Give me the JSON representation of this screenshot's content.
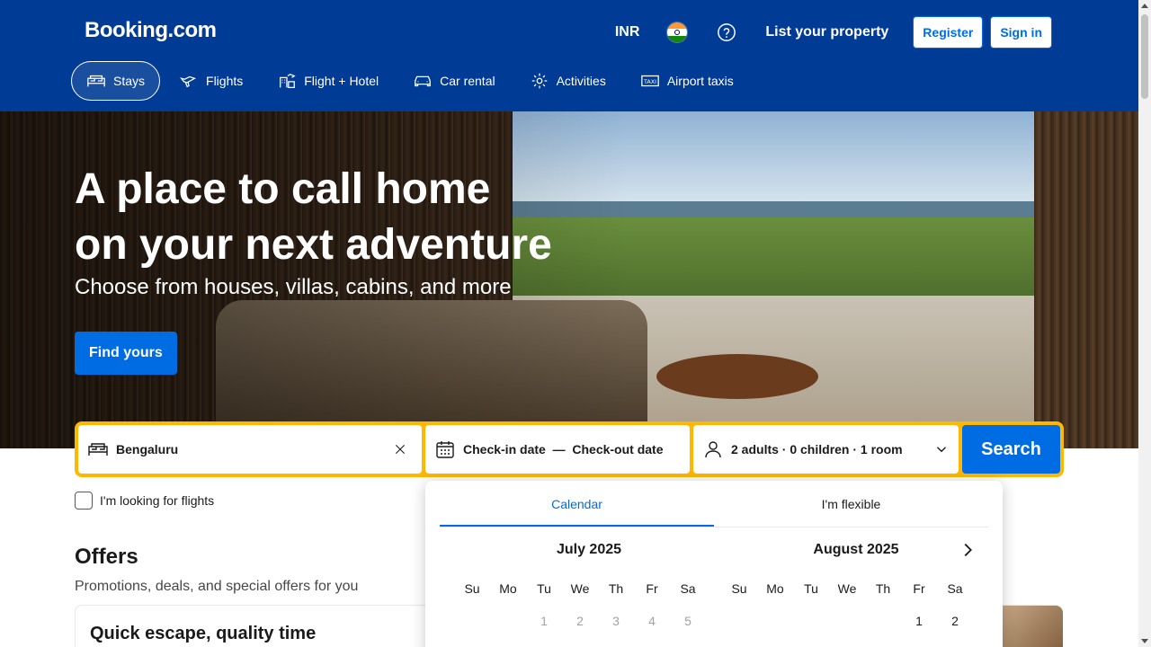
{
  "header": {
    "logo": "Booking.com",
    "currency": "INR",
    "list_property": "List your property",
    "register": "Register",
    "sign_in": "Sign in"
  },
  "nav": {
    "items": [
      {
        "label": "Stays",
        "icon": "bed-icon",
        "active": true
      },
      {
        "label": "Flights",
        "icon": "plane-icon"
      },
      {
        "label": "Flight + Hotel",
        "icon": "flight-hotel-icon"
      },
      {
        "label": "Car rental",
        "icon": "car-icon"
      },
      {
        "label": "Activities",
        "icon": "activities-icon"
      },
      {
        "label": "Airport taxis",
        "icon": "taxi-icon"
      }
    ]
  },
  "hero": {
    "title_line1": "A place to call home",
    "title_line2": "on your next adventure",
    "subtitle": "Choose from houses, villas, cabins, and more",
    "cta": "Find yours"
  },
  "search": {
    "destination": "Bengaluru",
    "checkin": "Check-in date",
    "separator": "—",
    "checkout": "Check-out date",
    "guests": "2 adults · 0 children · 1 room",
    "button": "Search",
    "accent_color": "#ffb700"
  },
  "flights_checkbox": "I'm looking for flights",
  "offers": {
    "title": "Offers",
    "subtitle": "Promotions, deals, and special offers for you",
    "card_title": "Quick escape, quality time"
  },
  "calendar": {
    "tabs": [
      "Calendar",
      "I'm flexible"
    ],
    "active_tab": "Calendar",
    "months": [
      {
        "title": "July 2025",
        "days": [
          "",
          "",
          "1",
          "2",
          "3",
          "4",
          "5"
        ]
      },
      {
        "title": "August 2025",
        "days": [
          "",
          "",
          "",
          "",
          "",
          "1",
          "2"
        ]
      }
    ],
    "weekdays": [
      "Su",
      "Mo",
      "Tu",
      "We",
      "Th",
      "Fr",
      "Sa"
    ]
  },
  "colors": {
    "brand": "#003b95",
    "primary": "#006ce4"
  }
}
